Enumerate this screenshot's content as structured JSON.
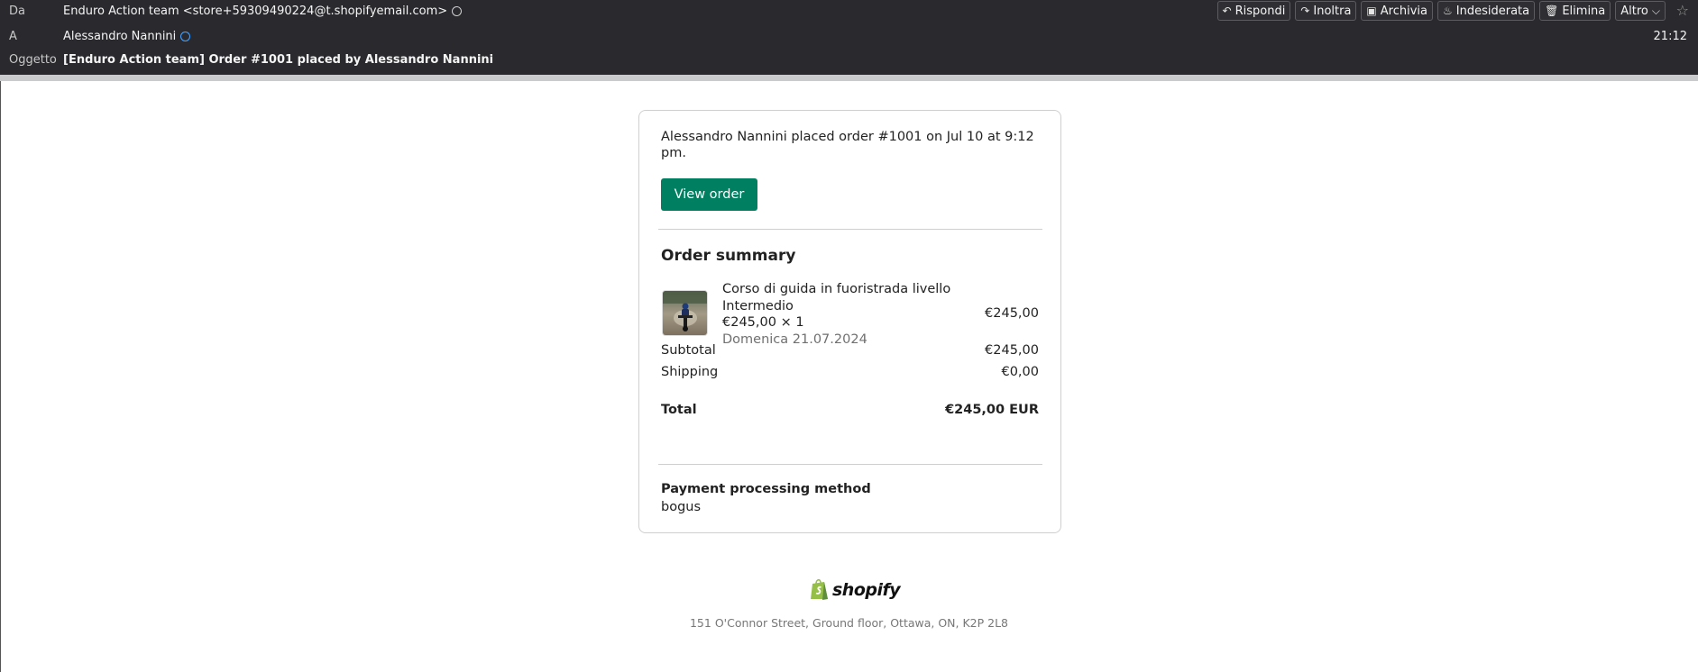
{
  "header": {
    "from_label": "Da",
    "from_value": "Enduro Action team <store+59309490224@t.shopifyemail.com>",
    "to_label": "A",
    "to_value": "Alessandro Nannini",
    "subject_label": "Oggetto",
    "subject_value": "[Enduro Action team] Order #1001 placed by Alessandro Nannini",
    "time": "21:12",
    "toolbar": {
      "reply": "Rispondi",
      "forward": "Inoltra",
      "archive": "Archivia",
      "junk": "Indesiderata",
      "delete": "Elimina",
      "more": "Altro"
    }
  },
  "email": {
    "intro": "Alessandro Nannini placed order #1001 on Jul 10 at 9:12 pm.",
    "view_button": "View order",
    "summary_title": "Order summary",
    "item": {
      "name": "Corso di guida in fuoristrada livello Intermedio",
      "qty_line": "€245,00 × 1",
      "date": "Domenica 21.07.2024",
      "price": "€245,00"
    },
    "subtotal_label": "Subtotal",
    "subtotal_value": "€245,00",
    "shipping_label": "Shipping",
    "shipping_value": "€0,00",
    "total_label": "Total",
    "total_value": "€245,00 EUR",
    "payment_title": "Payment processing method",
    "payment_value": "bogus"
  },
  "footer": {
    "logo_text": "shopify",
    "address": "151 O'Connor Street, Ground floor, Ottawa, ON, K2P 2L8"
  },
  "colors": {
    "header_bg": "#2a2a2e",
    "button_green": "#008060",
    "shopify_green": "#95bf47"
  }
}
